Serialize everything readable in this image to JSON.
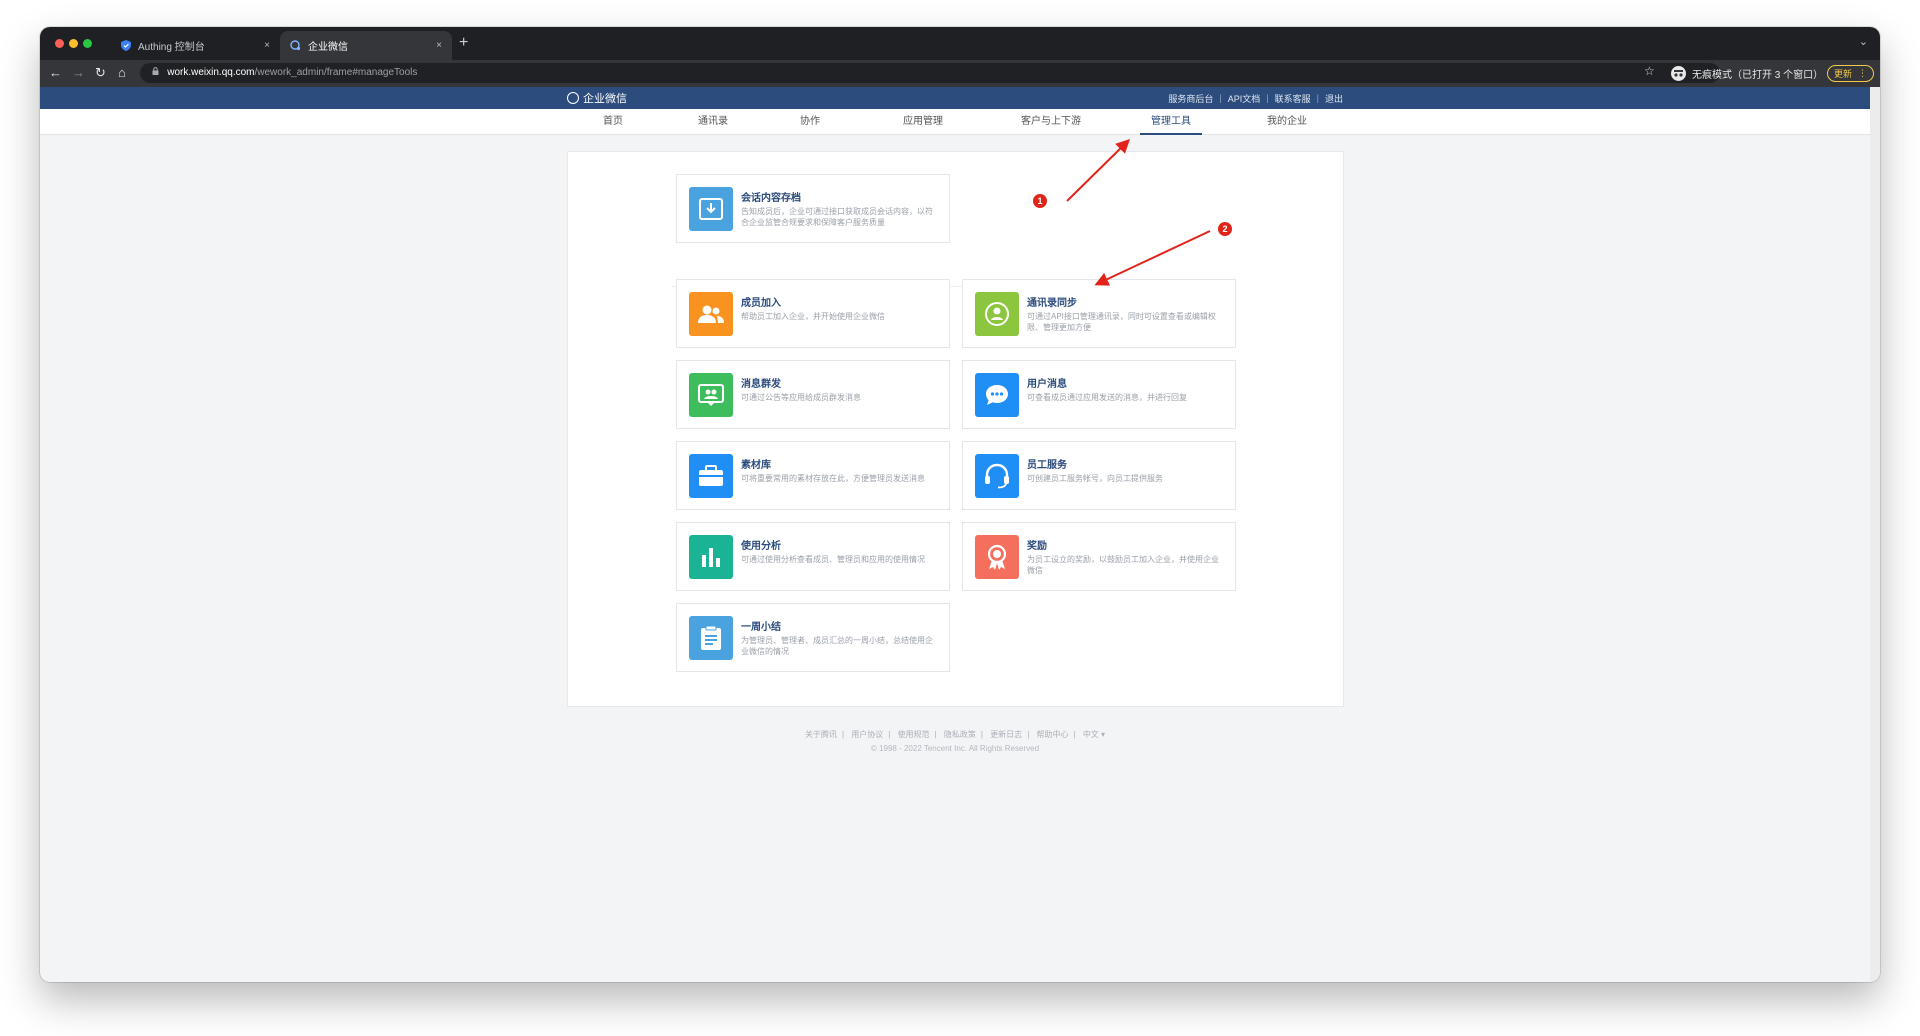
{
  "browser": {
    "tabs": [
      {
        "label": "Authing 控制台",
        "close": "×"
      },
      {
        "label": "企业微信",
        "close": "×"
      }
    ],
    "new_tab": "+",
    "tab_menu": "⌄",
    "nav": {
      "back": "←",
      "forward": "→",
      "reload": "↻",
      "home": "⌂"
    },
    "url_host": "work.weixin.qq.com",
    "url_path": "/wework_admin/frame#manageTools",
    "bookmark": "☆",
    "incognito_label": "无痕模式（已打开 3 个窗口）",
    "update_label": "更新",
    "update_menu": "⋮"
  },
  "header": {
    "logo_text": "企业微信",
    "links": [
      "服务商后台",
      "API文档",
      "联系客服",
      "退出"
    ],
    "sep": "|"
  },
  "nav": {
    "items": [
      "首页",
      "通讯录",
      "协作",
      "应用管理",
      "客户与上下游",
      "管理工具",
      "我的企业"
    ],
    "active": "管理工具"
  },
  "tools": {
    "archive": {
      "title": "会话内容存档",
      "desc": "告知成员后，企业可通过接口获取成员会话内容，以符合企业监管合规要求和保障客户服务质量"
    },
    "join": {
      "title": "成员加入",
      "desc": "帮助员工加入企业，并开始使用企业微信"
    },
    "sync": {
      "title": "通讯录同步",
      "desc": "可通过API接口管理通讯录，同时可设置查看或编辑权限、管理更加方便"
    },
    "broadcast": {
      "title": "消息群发",
      "desc": "可通过公告等应用给成员群发消息"
    },
    "usermsg": {
      "title": "用户消息",
      "desc": "可查看成员通过应用发送的消息，并进行回复"
    },
    "material": {
      "title": "素材库",
      "desc": "可将重要常用的素材存放在此，方便管理员发送消息"
    },
    "service": {
      "title": "员工服务",
      "desc": "可创建员工服务帐号，向员工提供服务"
    },
    "analytics": {
      "title": "使用分析",
      "desc": "可通过使用分析查看成员、管理员和应用的使用情况"
    },
    "reward": {
      "title": "奖励",
      "desc": "为员工设立的奖励，以鼓励员工加入企业，并使用企业微信"
    },
    "weekly": {
      "title": "一周小结",
      "desc": "为管理员、管理者、成员汇总的一周小结，总结使用企业微信的情况"
    }
  },
  "colors": {
    "archive": "#4aa3df",
    "join": "#f7931e",
    "sync": "#8cc63f",
    "broadcast": "#3dbd5b",
    "usermsg": "#1f8ff5",
    "material": "#1f8ff5",
    "service": "#1f8ff5",
    "analytics": "#1ab394",
    "reward": "#f4705c",
    "weekly": "#4aa3df",
    "brand": "#2c4c7d",
    "annotation": "#e2231a"
  },
  "footer": {
    "links": [
      "关于腾讯",
      "用户协议",
      "使用规范",
      "隐私政策",
      "更新日志",
      "帮助中心",
      "中文 ▾"
    ],
    "sep": "|",
    "copyright": "© 1998 - 2022 Tencent Inc. All Rights Reserved"
  },
  "annotations": {
    "marker_1": "1",
    "marker_2": "2"
  }
}
